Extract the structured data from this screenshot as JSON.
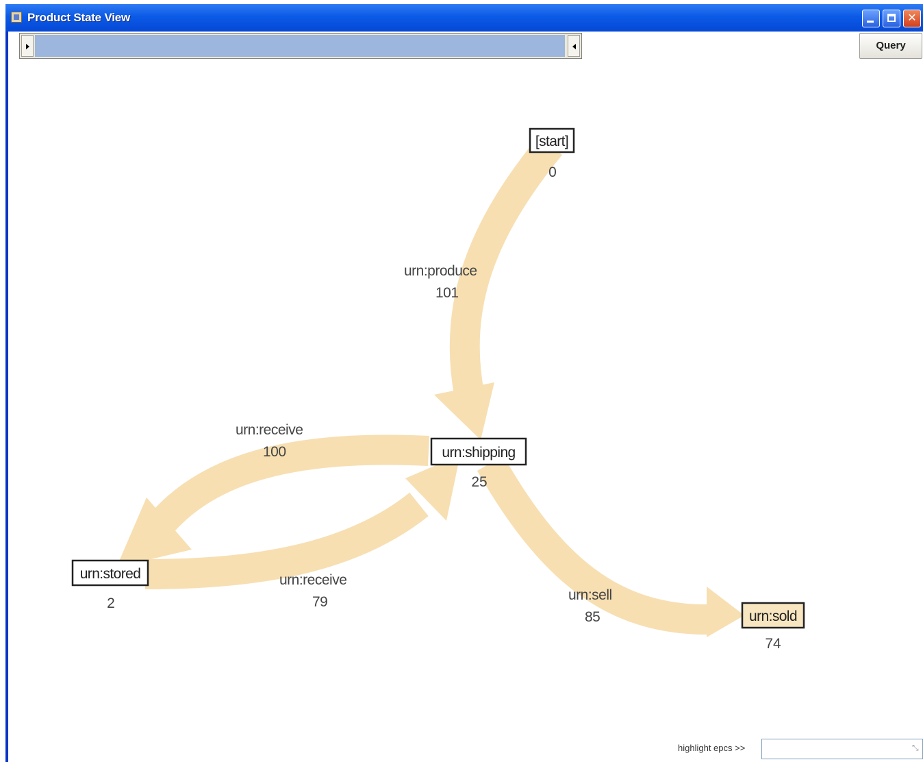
{
  "window": {
    "title": "Product State View",
    "controls": {
      "minimize": "minimize",
      "maximize": "maximize",
      "close": "close"
    }
  },
  "toolbar": {
    "query_label": "Query"
  },
  "graph": {
    "edge_color": "#f7dfb2",
    "nodes": [
      {
        "id": "start",
        "label": "[start]",
        "count": "0",
        "highlighted": false
      },
      {
        "id": "shipping",
        "label": "urn:shipping",
        "count": "25",
        "highlighted": false
      },
      {
        "id": "stored",
        "label": "urn:stored",
        "count": "2",
        "highlighted": false
      },
      {
        "id": "sold",
        "label": "urn:sold",
        "count": "74",
        "highlighted": true,
        "fill": "#f8e6c0"
      }
    ],
    "edges": [
      {
        "from": "start",
        "to": "shipping",
        "label": "urn:produce",
        "count": "101"
      },
      {
        "from": "shipping",
        "to": "stored",
        "label": "urn:receive",
        "count": "100"
      },
      {
        "from": "stored",
        "to": "shipping",
        "label": "urn:receive",
        "count": "79"
      },
      {
        "from": "shipping",
        "to": "sold",
        "label": "urn:sell",
        "count": "85"
      }
    ]
  },
  "footer": {
    "highlight_label": "highlight epcs >>",
    "highlight_value": ""
  }
}
